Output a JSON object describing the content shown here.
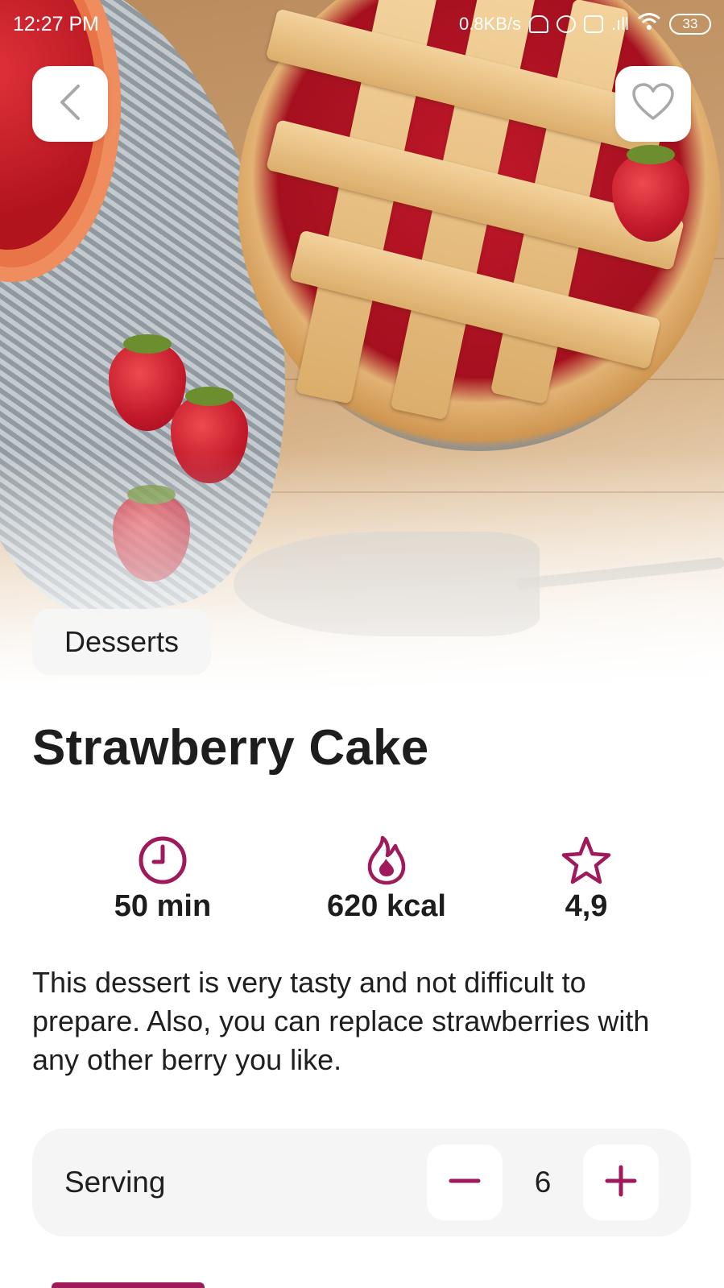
{
  "status_bar": {
    "time": "12:27 PM",
    "network_speed": "0.8KB/s",
    "battery": "33"
  },
  "header": {
    "back_icon": "chevron-left-icon",
    "favorite_icon": "heart-outline-icon"
  },
  "recipe": {
    "category": "Desserts",
    "title": "Strawberry Cake",
    "stats": [
      {
        "icon": "clock-icon",
        "value": "50 min"
      },
      {
        "icon": "flame-icon",
        "value": "620 kcal"
      },
      {
        "icon": "star-icon",
        "value": "4,9"
      }
    ],
    "description": "This dessert is very tasty and not difficult to prepare. Also, you can replace strawberries with any other berry you like."
  },
  "serving": {
    "label": "Serving",
    "value": "6",
    "decrement_icon": "minus-icon",
    "increment_icon": "plus-icon"
  },
  "colors": {
    "accent": "#a0195a",
    "card_bg": "#f5f5f5",
    "text": "#1d1d1d"
  }
}
